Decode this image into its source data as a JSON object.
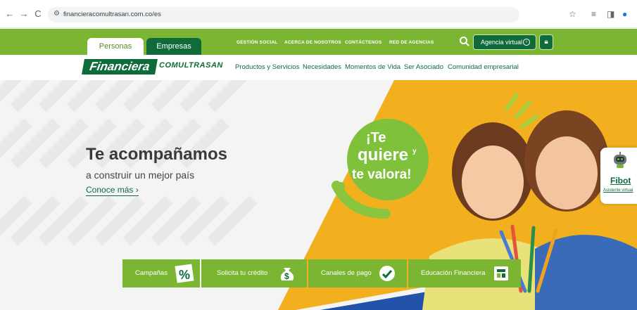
{
  "browser": {
    "url": "financieracomultrasan.com.co/es"
  },
  "header": {
    "tabs": [
      {
        "label": "Personas"
      },
      {
        "label": "Empresas"
      }
    ],
    "top_links": [
      "GESTIÓN SOCIAL",
      "ACERCA DE NOSOTROS",
      "CONTÁCTENOS",
      "RED DE AGENCIAS"
    ],
    "agencia_label": "Agencia virtual"
  },
  "logo": {
    "part1": "Financiera",
    "part2": "COMULTRASAN"
  },
  "menu": [
    "Productos y Servicios",
    "Necesidades",
    "Momentos de Vida",
    "Ser Asociado",
    "Comunidad empresarial"
  ],
  "hero": {
    "title": "Te acompañamos",
    "subtitle": "a construir un mejor país",
    "link": "Conoce más ›",
    "slogan": {
      "line1": "¡Te",
      "line2": "quiere",
      "line3": "y",
      "line4": "te valora!"
    }
  },
  "bottom_tabs": [
    {
      "label": "Campañas",
      "icon": "percent-icon"
    },
    {
      "label": "Solicita tu crédito",
      "icon": "money-bag-icon"
    },
    {
      "label": "Canales de pago",
      "icon": "payment-icon"
    },
    {
      "label": "Educación Financiera",
      "icon": "education-icon"
    }
  ],
  "fibot": {
    "title": "Fibot",
    "subtitle": "Asistente virtual"
  },
  "colors": {
    "brand_green": "#7ab632",
    "dark_green": "#0f6b3a",
    "accent_yellow": "#f2b01e",
    "accent_blue": "#2353a8"
  }
}
